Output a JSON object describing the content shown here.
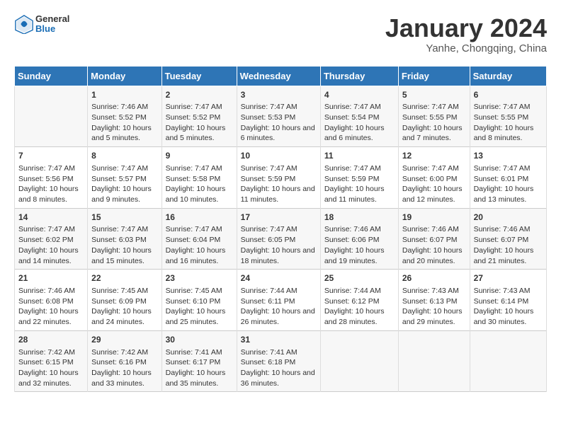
{
  "header": {
    "logo_general": "General",
    "logo_blue": "Blue",
    "month_title": "January 2024",
    "subtitle": "Yanhe, Chongqing, China"
  },
  "days_of_week": [
    "Sunday",
    "Monday",
    "Tuesday",
    "Wednesday",
    "Thursday",
    "Friday",
    "Saturday"
  ],
  "weeks": [
    [
      {
        "day": "",
        "sunrise": "",
        "sunset": "",
        "daylight": ""
      },
      {
        "day": "1",
        "sunrise": "Sunrise: 7:46 AM",
        "sunset": "Sunset: 5:52 PM",
        "daylight": "Daylight: 10 hours and 5 minutes."
      },
      {
        "day": "2",
        "sunrise": "Sunrise: 7:47 AM",
        "sunset": "Sunset: 5:52 PM",
        "daylight": "Daylight: 10 hours and 5 minutes."
      },
      {
        "day": "3",
        "sunrise": "Sunrise: 7:47 AM",
        "sunset": "Sunset: 5:53 PM",
        "daylight": "Daylight: 10 hours and 6 minutes."
      },
      {
        "day": "4",
        "sunrise": "Sunrise: 7:47 AM",
        "sunset": "Sunset: 5:54 PM",
        "daylight": "Daylight: 10 hours and 6 minutes."
      },
      {
        "day": "5",
        "sunrise": "Sunrise: 7:47 AM",
        "sunset": "Sunset: 5:55 PM",
        "daylight": "Daylight: 10 hours and 7 minutes."
      },
      {
        "day": "6",
        "sunrise": "Sunrise: 7:47 AM",
        "sunset": "Sunset: 5:55 PM",
        "daylight": "Daylight: 10 hours and 8 minutes."
      }
    ],
    [
      {
        "day": "7",
        "sunrise": "Sunrise: 7:47 AM",
        "sunset": "Sunset: 5:56 PM",
        "daylight": "Daylight: 10 hours and 8 minutes."
      },
      {
        "day": "8",
        "sunrise": "Sunrise: 7:47 AM",
        "sunset": "Sunset: 5:57 PM",
        "daylight": "Daylight: 10 hours and 9 minutes."
      },
      {
        "day": "9",
        "sunrise": "Sunrise: 7:47 AM",
        "sunset": "Sunset: 5:58 PM",
        "daylight": "Daylight: 10 hours and 10 minutes."
      },
      {
        "day": "10",
        "sunrise": "Sunrise: 7:47 AM",
        "sunset": "Sunset: 5:59 PM",
        "daylight": "Daylight: 10 hours and 11 minutes."
      },
      {
        "day": "11",
        "sunrise": "Sunrise: 7:47 AM",
        "sunset": "Sunset: 5:59 PM",
        "daylight": "Daylight: 10 hours and 11 minutes."
      },
      {
        "day": "12",
        "sunrise": "Sunrise: 7:47 AM",
        "sunset": "Sunset: 6:00 PM",
        "daylight": "Daylight: 10 hours and 12 minutes."
      },
      {
        "day": "13",
        "sunrise": "Sunrise: 7:47 AM",
        "sunset": "Sunset: 6:01 PM",
        "daylight": "Daylight: 10 hours and 13 minutes."
      }
    ],
    [
      {
        "day": "14",
        "sunrise": "Sunrise: 7:47 AM",
        "sunset": "Sunset: 6:02 PM",
        "daylight": "Daylight: 10 hours and 14 minutes."
      },
      {
        "day": "15",
        "sunrise": "Sunrise: 7:47 AM",
        "sunset": "Sunset: 6:03 PM",
        "daylight": "Daylight: 10 hours and 15 minutes."
      },
      {
        "day": "16",
        "sunrise": "Sunrise: 7:47 AM",
        "sunset": "Sunset: 6:04 PM",
        "daylight": "Daylight: 10 hours and 16 minutes."
      },
      {
        "day": "17",
        "sunrise": "Sunrise: 7:47 AM",
        "sunset": "Sunset: 6:05 PM",
        "daylight": "Daylight: 10 hours and 18 minutes."
      },
      {
        "day": "18",
        "sunrise": "Sunrise: 7:46 AM",
        "sunset": "Sunset: 6:06 PM",
        "daylight": "Daylight: 10 hours and 19 minutes."
      },
      {
        "day": "19",
        "sunrise": "Sunrise: 7:46 AM",
        "sunset": "Sunset: 6:07 PM",
        "daylight": "Daylight: 10 hours and 20 minutes."
      },
      {
        "day": "20",
        "sunrise": "Sunrise: 7:46 AM",
        "sunset": "Sunset: 6:07 PM",
        "daylight": "Daylight: 10 hours and 21 minutes."
      }
    ],
    [
      {
        "day": "21",
        "sunrise": "Sunrise: 7:46 AM",
        "sunset": "Sunset: 6:08 PM",
        "daylight": "Daylight: 10 hours and 22 minutes."
      },
      {
        "day": "22",
        "sunrise": "Sunrise: 7:45 AM",
        "sunset": "Sunset: 6:09 PM",
        "daylight": "Daylight: 10 hours and 24 minutes."
      },
      {
        "day": "23",
        "sunrise": "Sunrise: 7:45 AM",
        "sunset": "Sunset: 6:10 PM",
        "daylight": "Daylight: 10 hours and 25 minutes."
      },
      {
        "day": "24",
        "sunrise": "Sunrise: 7:44 AM",
        "sunset": "Sunset: 6:11 PM",
        "daylight": "Daylight: 10 hours and 26 minutes."
      },
      {
        "day": "25",
        "sunrise": "Sunrise: 7:44 AM",
        "sunset": "Sunset: 6:12 PM",
        "daylight": "Daylight: 10 hours and 28 minutes."
      },
      {
        "day": "26",
        "sunrise": "Sunrise: 7:43 AM",
        "sunset": "Sunset: 6:13 PM",
        "daylight": "Daylight: 10 hours and 29 minutes."
      },
      {
        "day": "27",
        "sunrise": "Sunrise: 7:43 AM",
        "sunset": "Sunset: 6:14 PM",
        "daylight": "Daylight: 10 hours and 30 minutes."
      }
    ],
    [
      {
        "day": "28",
        "sunrise": "Sunrise: 7:42 AM",
        "sunset": "Sunset: 6:15 PM",
        "daylight": "Daylight: 10 hours and 32 minutes."
      },
      {
        "day": "29",
        "sunrise": "Sunrise: 7:42 AM",
        "sunset": "Sunset: 6:16 PM",
        "daylight": "Daylight: 10 hours and 33 minutes."
      },
      {
        "day": "30",
        "sunrise": "Sunrise: 7:41 AM",
        "sunset": "Sunset: 6:17 PM",
        "daylight": "Daylight: 10 hours and 35 minutes."
      },
      {
        "day": "31",
        "sunrise": "Sunrise: 7:41 AM",
        "sunset": "Sunset: 6:18 PM",
        "daylight": "Daylight: 10 hours and 36 minutes."
      },
      {
        "day": "",
        "sunrise": "",
        "sunset": "",
        "daylight": ""
      },
      {
        "day": "",
        "sunrise": "",
        "sunset": "",
        "daylight": ""
      },
      {
        "day": "",
        "sunrise": "",
        "sunset": "",
        "daylight": ""
      }
    ]
  ]
}
